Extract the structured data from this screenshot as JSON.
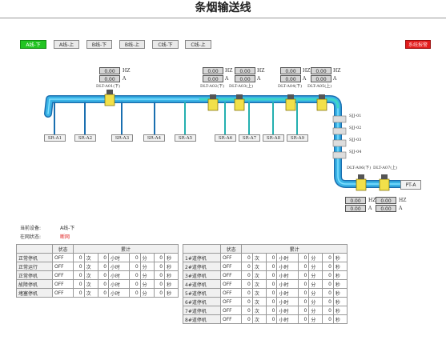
{
  "title": "条烟输送线",
  "lines": [
    "A线-下",
    "A线-上",
    "B线-下",
    "B线-上",
    "C线-下",
    "C线-上"
  ],
  "alarm_label": "系统报警",
  "drives": [
    {
      "hz": "0.00",
      "a": "0.00",
      "label": "DLT-A01(下)"
    },
    {
      "hz": "0.00",
      "a": "0.00",
      "label": "DLT-A02(下)"
    },
    {
      "hz": "0.00",
      "a": "0.00",
      "label": "DLT-A03(上)"
    },
    {
      "hz": "0.00",
      "a": "0.00",
      "label": "DLT-A04(下)"
    },
    {
      "hz": "0.00",
      "a": "0.00",
      "label": "DLT-A05(上)"
    },
    {
      "hz": "0.00",
      "a": "0.00",
      "label": "DLT-A06(下)"
    },
    {
      "hz": "0.00",
      "a": "0.00",
      "label": "DLT-A07(上)"
    }
  ],
  "units": {
    "hz": "HZ",
    "a": "A"
  },
  "stations": [
    "SR-A1",
    "SR-A2",
    "SR-A3",
    "SR-A4",
    "SR-A5",
    "SR-A6",
    "SR-A7",
    "SR-A8",
    "SR-A9"
  ],
  "sjj": [
    "SJJ-01",
    "SJJ-02",
    "SJJ-03",
    "SJJ-04"
  ],
  "pt": "PT-A",
  "status": {
    "device_label": "当前设备:",
    "device_value": "A线-下",
    "online_label": "在网状态:",
    "online_value": "断网",
    "online_color": "#e02020"
  },
  "table_headers": {
    "status": "状态",
    "total": "累计"
  },
  "time_units": {
    "times": "次",
    "hour": "小时",
    "min": "分",
    "sec": "秒"
  },
  "left_rows": [
    {
      "name": "正常停机",
      "state": "OFF",
      "count": "0",
      "h": "0",
      "m": "0",
      "s": "0"
    },
    {
      "name": "正常运行",
      "state": "OFF",
      "count": "0",
      "h": "0",
      "m": "0",
      "s": "0"
    },
    {
      "name": "正常停机",
      "state": "OFF",
      "count": "0",
      "h": "0",
      "m": "0",
      "s": "0"
    },
    {
      "name": "故障停机",
      "state": "OFF",
      "count": "0",
      "h": "0",
      "m": "0",
      "s": "0"
    },
    {
      "name": "堵塞停机",
      "state": "OFF",
      "count": "0",
      "h": "0",
      "m": "0",
      "s": "0"
    }
  ],
  "right_rows": [
    {
      "name": "1#道停机",
      "state": "OFF",
      "count": "0",
      "h": "0",
      "m": "0",
      "s": "0"
    },
    {
      "name": "2#道停机",
      "state": "OFF",
      "count": "0",
      "h": "0",
      "m": "0",
      "s": "0"
    },
    {
      "name": "3#道停机",
      "state": "OFF",
      "count": "0",
      "h": "0",
      "m": "0",
      "s": "0"
    },
    {
      "name": "4#道停机",
      "state": "OFF",
      "count": "0",
      "h": "0",
      "m": "0",
      "s": "0"
    },
    {
      "name": "5#道停机",
      "state": "OFF",
      "count": "0",
      "h": "0",
      "m": "0",
      "s": "0"
    },
    {
      "name": "6#道停机",
      "state": "OFF",
      "count": "0",
      "h": "0",
      "m": "0",
      "s": "0"
    },
    {
      "name": "7#道停机",
      "state": "OFF",
      "count": "0",
      "h": "0",
      "m": "0",
      "s": "0"
    },
    {
      "name": "8#道停机",
      "state": "OFF",
      "count": "0",
      "h": "0",
      "m": "0",
      "s": "0"
    }
  ]
}
